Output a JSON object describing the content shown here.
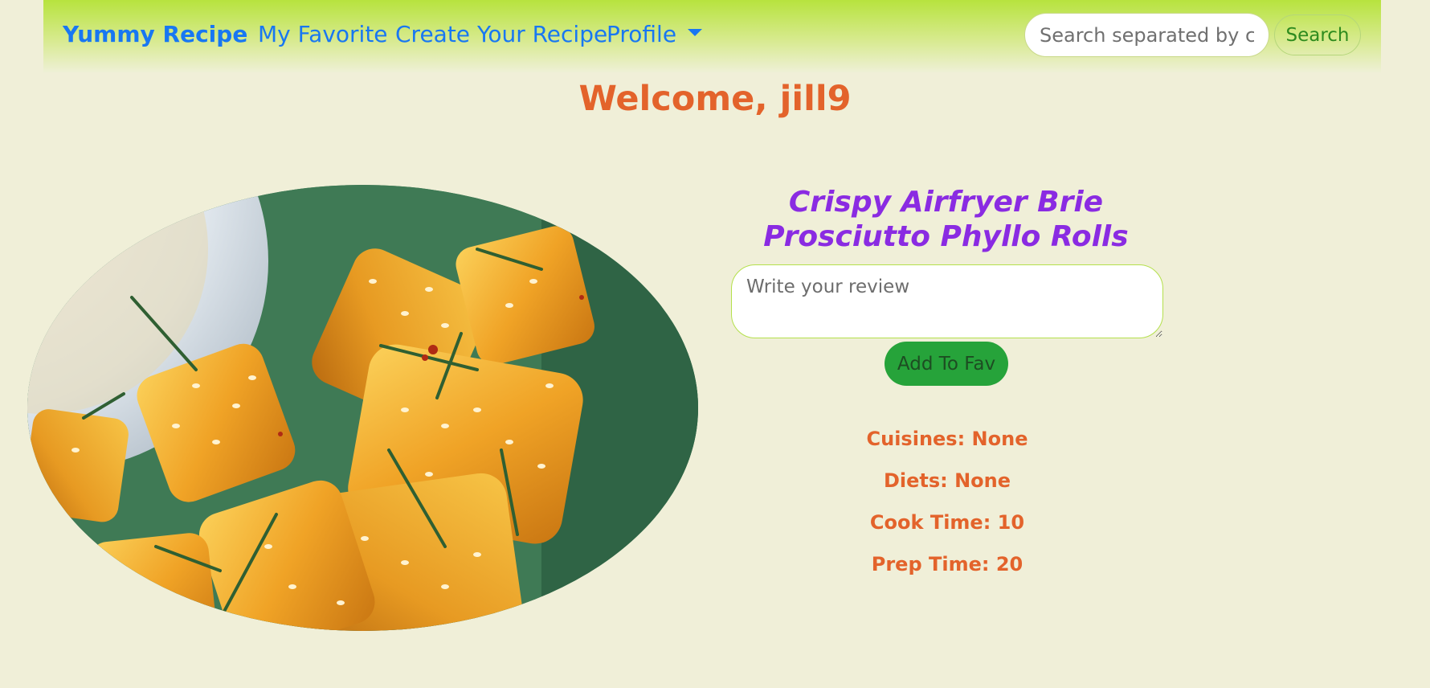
{
  "navbar": {
    "brand": "Yummy Recipe",
    "links": [
      {
        "label": "My Favorite"
      },
      {
        "label": "Create Your Recipe"
      },
      {
        "label": "Profile"
      }
    ],
    "search": {
      "placeholder": "Search separated by comma",
      "button_label": "Search"
    }
  },
  "welcome": "Welcome, jill9",
  "recipe": {
    "title": "Crispy Airfryer Brie Prosciutto Phyllo Rolls",
    "review_placeholder": "Write your review",
    "add_fav_label": "Add To Fav",
    "info": [
      "Cuisines: None",
      "Diets: None",
      "Cook Time: 10",
      "Prep Time: 20"
    ]
  },
  "colors": {
    "page_bg": "#f0efd8",
    "nav_gradient_top": "#b7e33e",
    "link": "#1877f2",
    "accent_orange": "#e3632b",
    "title_purple": "#8a2be2",
    "fav_green": "#26a33a"
  },
  "icons": {
    "profile_dropdown": "chevron-down-icon"
  }
}
